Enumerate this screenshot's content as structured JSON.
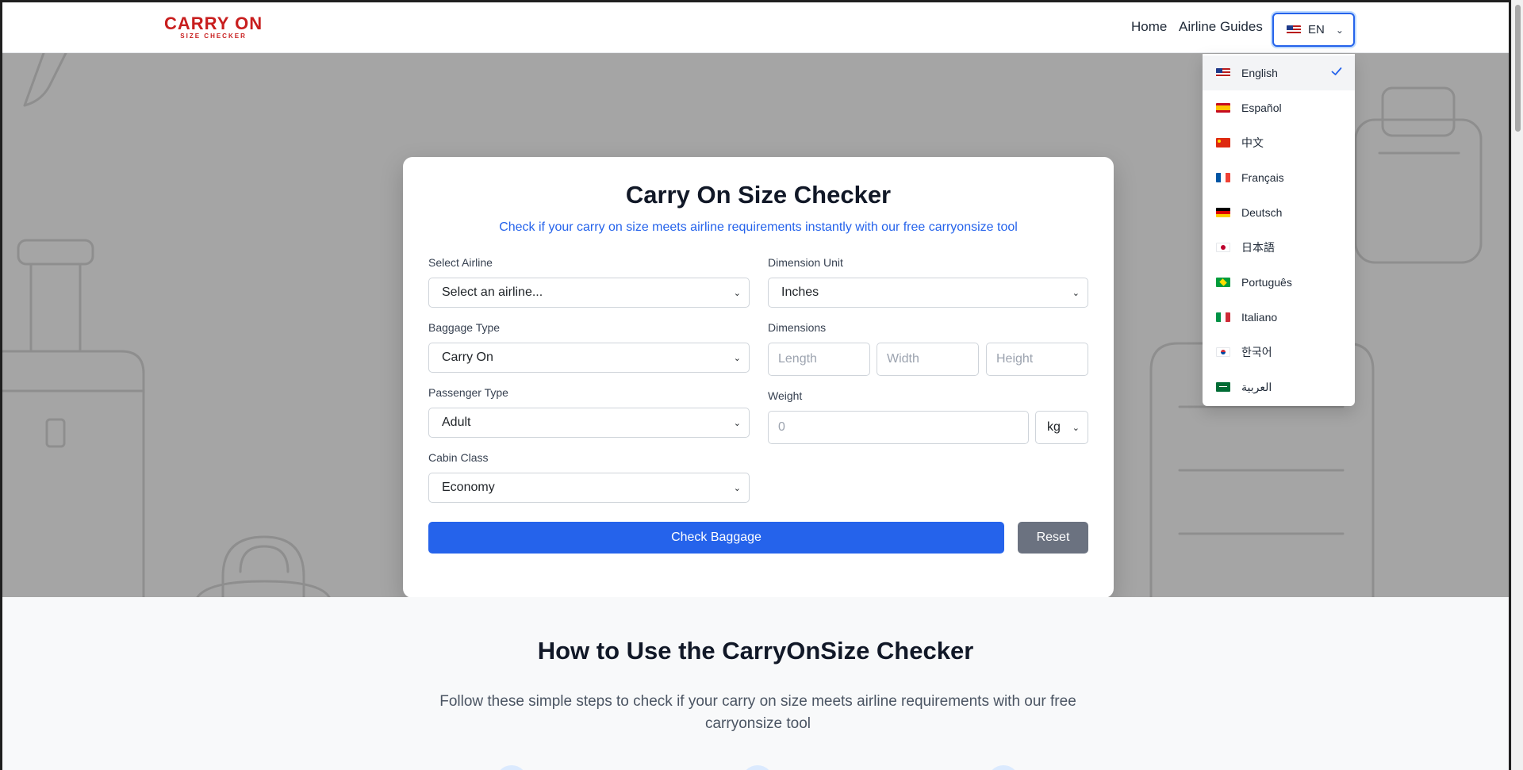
{
  "header": {
    "logo_main": "CARRY ON",
    "logo_sub": "SIZE CHECKER",
    "nav": {
      "home": "Home",
      "guides": "Airline Guides"
    },
    "lang_button": {
      "code": "EN",
      "flag": "us-flag-icon"
    }
  },
  "language_menu": {
    "selected": "English",
    "items": [
      {
        "label": "English",
        "flag": "us"
      },
      {
        "label": "Español",
        "flag": "es"
      },
      {
        "label": "中文",
        "flag": "cn"
      },
      {
        "label": "Français",
        "flag": "fr"
      },
      {
        "label": "Deutsch",
        "flag": "de"
      },
      {
        "label": "日本語",
        "flag": "jp"
      },
      {
        "label": "Português",
        "flag": "br"
      },
      {
        "label": "Italiano",
        "flag": "it"
      },
      {
        "label": "한국어",
        "flag": "kr"
      },
      {
        "label": "العربية",
        "flag": "sa"
      }
    ]
  },
  "checker": {
    "title": "Carry On Size Checker",
    "subtitle": "Check if your carry on size meets airline requirements instantly with our free carryonsize tool",
    "airline": {
      "label": "Select Airline",
      "value": "Select an airline..."
    },
    "baggage_type": {
      "label": "Baggage Type",
      "value": "Carry On"
    },
    "passenger_type": {
      "label": "Passenger Type",
      "value": "Adult"
    },
    "cabin_class": {
      "label": "Cabin Class",
      "value": "Economy"
    },
    "dimension_unit": {
      "label": "Dimension Unit",
      "value": "Inches"
    },
    "dimensions": {
      "label": "Dimensions",
      "length_placeholder": "Length",
      "width_placeholder": "Width",
      "height_placeholder": "Height"
    },
    "weight": {
      "label": "Weight",
      "placeholder": "0",
      "unit": "kg"
    },
    "check_button": "Check Baggage",
    "reset_button": "Reset"
  },
  "howto": {
    "title": "How to Use the CarryOnSize Checker",
    "description": "Follow these simple steps to check if your carry on size meets airline requirements with our free carryonsize tool"
  },
  "colors": {
    "accent": "#2563eb",
    "brand": "#c81e1e",
    "hero_bg": "#a5a5a5",
    "reset": "#6b7280"
  }
}
